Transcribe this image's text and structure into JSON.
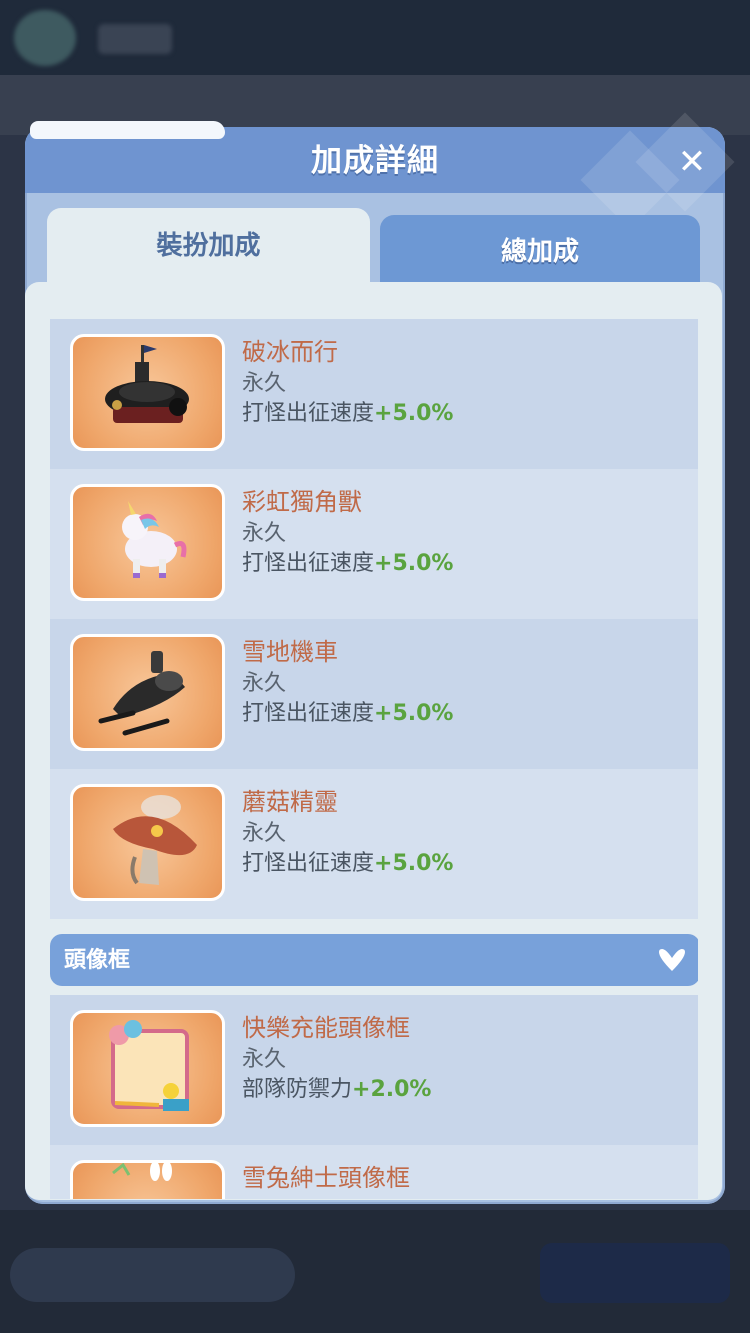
{
  "modal": {
    "title": "加成詳細",
    "close_symbol": "✕",
    "tabs": [
      {
        "label": "裝扮加成",
        "active": true
      },
      {
        "label": "總加成",
        "active": false
      }
    ]
  },
  "items": [
    {
      "name": "破冰而行",
      "duration": "永久",
      "bonus_label": "打怪出征速度",
      "bonus_value": "+5.0%",
      "icon": "icebreaker-ship-icon"
    },
    {
      "name": "彩虹獨角獸",
      "duration": "永久",
      "bonus_label": "打怪出征速度",
      "bonus_value": "+5.0%",
      "icon": "rainbow-unicorn-icon"
    },
    {
      "name": "雪地機車",
      "duration": "永久",
      "bonus_label": "打怪出征速度",
      "bonus_value": "+5.0%",
      "icon": "snowmobile-icon"
    },
    {
      "name": "蘑菇精靈",
      "duration": "永久",
      "bonus_label": "打怪出征速度",
      "bonus_value": "+5.0%",
      "icon": "mushroom-spirit-icon"
    }
  ],
  "avatar_section": {
    "label": "頭像框",
    "expanded": true,
    "items": [
      {
        "name": "快樂充能頭像框",
        "duration": "永久",
        "bonus_label": "部隊防禦力",
        "bonus_value": "+2.0%",
        "icon": "happy-charge-frame-icon"
      },
      {
        "name": "雪兔紳士頭像框",
        "icon": "snow-rabbit-frame-icon"
      }
    ]
  },
  "colors": {
    "name_text": "#c06a48",
    "bonus_value": "#5aa33f",
    "header": "#6f94d0",
    "section_header": "#78a1da"
  }
}
